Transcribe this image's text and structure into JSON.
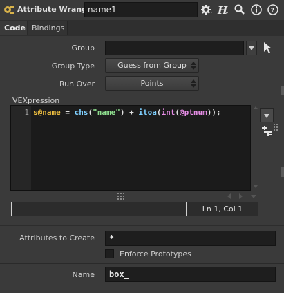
{
  "header": {
    "node_type": "Attribute Wrangle",
    "node_name": "name1"
  },
  "tabs": [
    {
      "label": "Code",
      "active": true
    },
    {
      "label": "Bindings",
      "active": false
    }
  ],
  "params": {
    "group_label": "Group",
    "group_value": "",
    "group_type_label": "Group Type",
    "group_type_value": "Guess from Group",
    "run_over_label": "Run Over",
    "run_over_value": "Points",
    "vex_label": "VEXpression",
    "code": {
      "line_number": "1",
      "line": "s@name = chs(\"name\") + itoa(int(@ptnum));"
    },
    "cursor_status": "Ln 1, Col 1",
    "attributes_label": "Attributes to Create",
    "attributes_value": "*",
    "enforce_label": "Enforce Prototypes",
    "enforce_checked": false,
    "name_label": "Name",
    "name_value": "box_"
  },
  "colors": {
    "background": "#3a3a3a",
    "field": "#1e1e1e",
    "code_keyword": "#f0c040",
    "code_string": "#8fe08f",
    "code_func": "#7fd0ff",
    "code_attr": "#e88ee8"
  }
}
